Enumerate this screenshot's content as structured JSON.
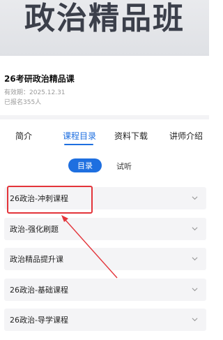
{
  "banner": {
    "title": "政治精品班"
  },
  "course": {
    "title": "26考研政治精品课",
    "validity": "有效期：2025.12.31",
    "enrolled": "已报名355人"
  },
  "tabs": [
    {
      "label": "简介"
    },
    {
      "label": "课程目录"
    },
    {
      "label": "资料下载"
    },
    {
      "label": "讲师介绍"
    }
  ],
  "subtabs": {
    "active": "目录",
    "other": "试听"
  },
  "chapters": [
    {
      "label": "26政治-冲刺课程"
    },
    {
      "label": "政治-强化刷题"
    },
    {
      "label": "政治精品提升课"
    },
    {
      "label": "26政治-基础课程"
    },
    {
      "label": "26政治-导学课程"
    }
  ],
  "colors": {
    "accent": "#1e6fe0",
    "annotation": "#e3343a"
  }
}
